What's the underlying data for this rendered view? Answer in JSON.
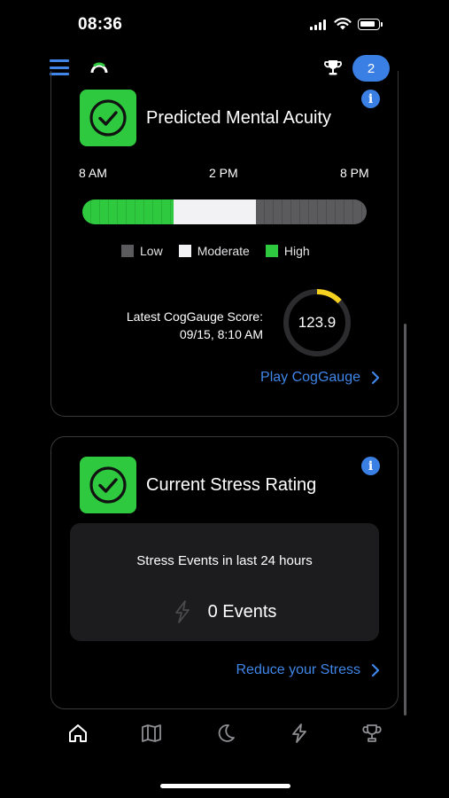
{
  "status_bar": {
    "time": "08:36"
  },
  "top_nav": {
    "notification_count": "2"
  },
  "acuity_card": {
    "title": "Predicted Mental Acuity",
    "time_labels": [
      "8 AM",
      "2 PM",
      "8 PM"
    ],
    "bar_fractions": {
      "high": 0.32,
      "moderate": 0.29,
      "low": 0.39
    },
    "legend": [
      {
        "label": "Low",
        "color": "#5b5b5e"
      },
      {
        "label": "Moderate",
        "color": "#f2f2f4"
      },
      {
        "label": "High",
        "color": "#2ec93f"
      }
    ],
    "score_label": "Latest CogGauge Score:",
    "score_timestamp": "09/15, 8:10 AM",
    "score_value": "123.9",
    "gauge_fraction": 0.13,
    "link": "Play CogGauge"
  },
  "stress_card": {
    "title": "Current Stress Rating",
    "events_heading": "Stress Events in last 24 hours",
    "events_value": "0 Events",
    "link": "Reduce your Stress"
  },
  "tab_bar": [
    "home-icon",
    "map-icon",
    "moon-icon",
    "lightning-icon",
    "trophy-icon"
  ],
  "colors": {
    "accent": "#3a7fe3",
    "success": "#2ec93f",
    "gauge": "#f4d21f"
  }
}
